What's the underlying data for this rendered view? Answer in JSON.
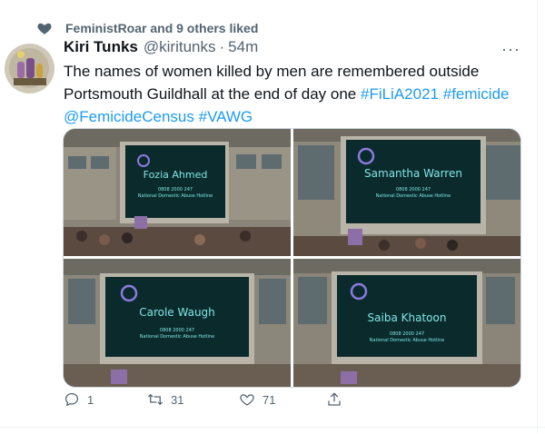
{
  "social_context": {
    "text": "FeministRoar and 9 others liked",
    "icon": "heart-icon"
  },
  "tweet": {
    "author_name": "Kiri Tunks",
    "handle": "@kiritunks",
    "separator": "·",
    "timestamp": "54m",
    "more_label": "···",
    "text_plain": "The names of women killed by men are remembered outside Portsmouth Guildhall at the end of day one ",
    "hashtag_1": "#FiLiA2021",
    "hashtag_2": "#femicide",
    "mention": "@FemicideCensus",
    "hashtag_3": "#VAWG"
  },
  "media": {
    "images": [
      {
        "name": "Fozia Ahmed",
        "line1": "0808 2000 247",
        "line2": "National Domestic Abuse Hotline"
      },
      {
        "name": "Samantha Warren",
        "line1": "0808 2000 247",
        "line2": "National Domestic Abuse Hotline"
      },
      {
        "name": "Carole Waugh",
        "line1": "0808 2000 247",
        "line2": "National Domestic Abuse Hotline"
      },
      {
        "name": "Saiba Khatoon",
        "line1": "0808 2000 247",
        "line2": "National Domestic Abuse Hotline"
      }
    ]
  },
  "actions": {
    "reply_count": "1",
    "retweet_count": "31",
    "like_count": "71",
    "share_label": ""
  },
  "colors": {
    "link": "#1d9bf0",
    "muted": "#536471",
    "screen_text": "#7fe6e6"
  }
}
